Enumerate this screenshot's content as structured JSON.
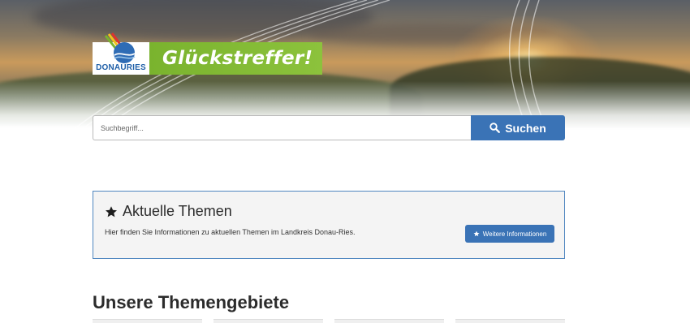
{
  "brand": {
    "logo_text": "DONAURIES",
    "banner_text": "Glückstreffer!",
    "banner_color": "#8cc23c",
    "logo_color": "#1f5fa8"
  },
  "search": {
    "placeholder": "Suchbegriff...",
    "value": "",
    "button_label": "Suchen",
    "button_icon": "search-icon",
    "button_color": "#3a73b6"
  },
  "current_topics": {
    "icon": "star-icon",
    "title": "Aktuelle Themen",
    "description": "Hier finden Sie Informationen zu aktuellen Themen im Landkreis Donau-Ries.",
    "button_label": "Weitere Informationen",
    "button_icon": "star-icon",
    "border_color": "#4f86c0"
  },
  "topic_areas": {
    "title": "Unsere Themengebiete"
  }
}
